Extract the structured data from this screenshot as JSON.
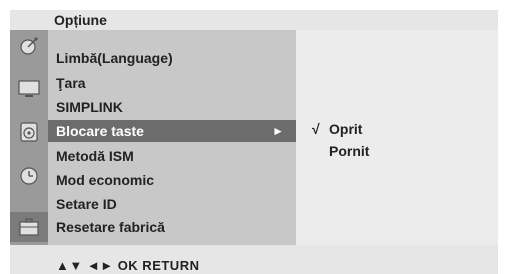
{
  "title": "Opțiune",
  "menu": {
    "items": [
      {
        "label": "Limbă(Language)"
      },
      {
        "label": "Ţara"
      },
      {
        "label": "SIMPLINK"
      },
      {
        "label": "Blocare taste"
      },
      {
        "label": "Metodă ISM"
      },
      {
        "label": "Mod economic"
      },
      {
        "label": "Setare ID"
      },
      {
        "label": "Resetare fabrică"
      }
    ],
    "selected_arrow": "►"
  },
  "submenu": {
    "check": "√",
    "items": [
      {
        "label": "Oprit"
      },
      {
        "label": "Pornit"
      }
    ]
  },
  "footer": {
    "hint": "▲▼  ◄►  OK  RETURN"
  },
  "icons": [
    "satellite-dish-icon",
    "tv-screen-icon",
    "speaker-icon",
    "clock-icon",
    "briefcase-icon"
  ],
  "colors": {
    "selected_bg": "#6c6c6c",
    "menu_bg": "#c8c8c8",
    "icon_col_bg": "#9a9a9a"
  }
}
